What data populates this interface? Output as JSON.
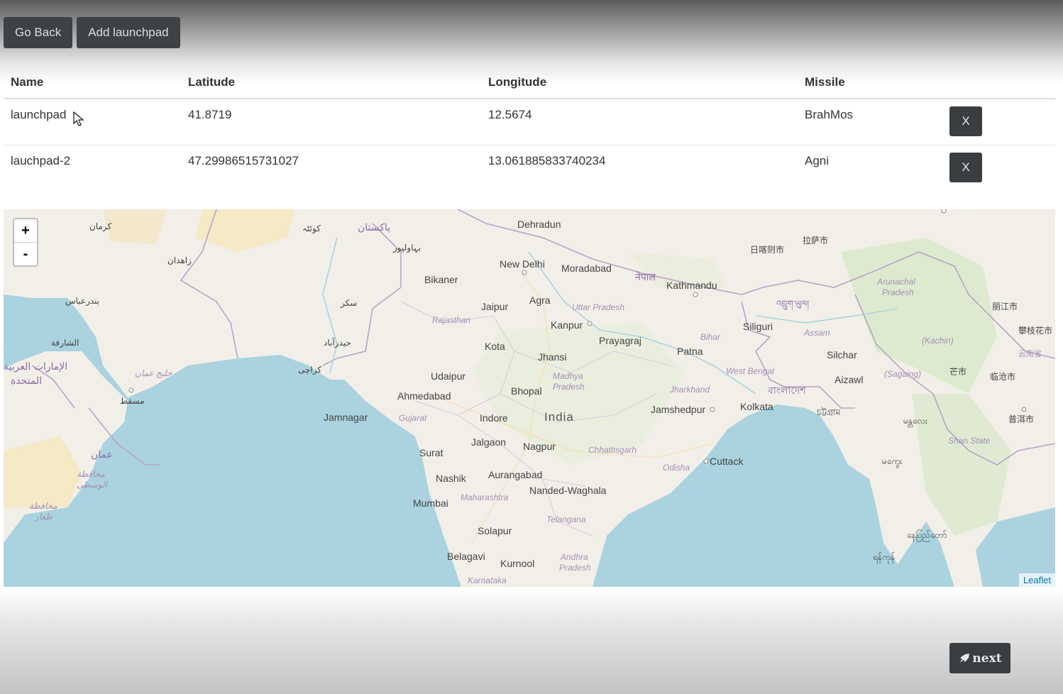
{
  "toolbar": {
    "back_label": "Go Back",
    "add_label": "Add launchpad"
  },
  "table": {
    "headers": [
      "Name",
      "Latitude",
      "Longitude",
      "Missile"
    ],
    "rows": [
      {
        "name": "launchpad",
        "latitude": "41.8719",
        "longitude": "12.5674",
        "missile": "BrahMos",
        "delete_label": "X"
      },
      {
        "name": "lauchpad-2",
        "latitude": "47.29986515731027",
        "longitude": "13.061885833740234",
        "missile": "Agni",
        "delete_label": "X"
      }
    ]
  },
  "map": {
    "zoom_in": "+",
    "zoom_out": "-",
    "attribution": "Leaflet",
    "labels": {
      "dehradun": "Dehradun",
      "new_delhi": "New Delhi",
      "moradabad": "Moradabad",
      "bikaner": "Bikaner",
      "jaipur": "Jaipur",
      "agra": "Agra",
      "uttar_pradesh": "Uttar Pradesh",
      "kathmandu": "Kathmandu",
      "rajasthan": "Rajasthan",
      "kanpur": "Kanpur",
      "prayagraj": "Prayagraj",
      "siliguri": "Siliguri",
      "assam": "Assam",
      "kota": "Kota",
      "jhansi": "Jhansi",
      "patna": "Patna",
      "bihar": "Bihar",
      "silchar": "Silchar",
      "udaipur": "Udaipur",
      "madhya_pradesh_1": "Madhya",
      "madhya_pradesh_2": "Pradesh",
      "west_bengal": "West Bengal",
      "jharkhand": "Jharkhand",
      "aizawl": "Aizawl",
      "ahmedabad": "Ahmedabad",
      "bhopal": "Bhopal",
      "kolkata": "Kolkata",
      "jamshedpur": "Jamshedpur",
      "jamnagar": "Jamnagar",
      "gujarat": "Gujarat",
      "indore": "Indore",
      "india": "India",
      "surat": "Surat",
      "jalgaon": "Jalgaon",
      "nagpur": "Nagpur",
      "chhattisgarh": "Chhattisgarh",
      "odisha": "Odisha",
      "cuttack": "Cuttack",
      "nashik": "Nashik",
      "aurangabad": "Aurangabad",
      "mumbai": "Mumbai",
      "maharashtra": "Maharashtra",
      "nanded": "Nanded-Waghala",
      "telangana": "Telangana",
      "solapur": "Solapur",
      "belagavi": "Belagavi",
      "kurnool": "Kurnool",
      "andhra_1": "Andhra",
      "andhra_2": "Pradesh",
      "karnataka": "Karnataka",
      "arunachal_1": "Arunachal",
      "arunachal_2": "Pradesh",
      "shan_state": "Shan State",
      "sagaing": "(Sagaing)",
      "kachin": "(Kachin)",
      "nepal": "नेपाल",
      "bangladesh": "বাংলাদেশ",
      "pakistan": "پاکستان",
      "oman": "عمان",
      "muscat": "مسقط",
      "uae_1": "الإمارات العربية",
      "uae_2": "المتحدة",
      "sharjah": "الشارقة",
      "bandar_abbas": "بندرعباس",
      "kerman": "کرمان",
      "zahedan": "زاهدان",
      "karachi": "کراچی",
      "hyderabad_pk": "حیدرآباد",
      "sukkur": "سکر",
      "bahawalpur": "بہاولپور",
      "quetta": "کوئٹہ",
      "gulf_oman": "خليج عمان",
      "wusta_1": "محافظة",
      "wusta_2": "الوسطى",
      "dhofar_1": "محافظة",
      "dhofar_2": "ظفار",
      "lhasa": "拉萨市",
      "shigatse": "日喀则市",
      "lijiang": "丽江市",
      "lincang": "临沧市",
      "puer": "普洱市",
      "mangshi": "芒市",
      "dali": "攀枝花市",
      "yunnan": "云南省",
      "bhutan": "འབྲུག་ཡུལ།",
      "chittagong": "চট্টগ্রাম",
      "mandalay": "မန္တလေး",
      "magway": "မကွေး",
      "yangon": "ရန်ကုန်",
      "naypyidaw": "နေပြည်တော်"
    }
  },
  "next_button": {
    "label": "next"
  },
  "colors": {
    "button_bg": "#3f4244",
    "water": "#aad3df",
    "land": "#f2efe9"
  }
}
